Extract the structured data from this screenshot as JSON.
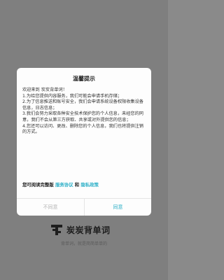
{
  "dialog": {
    "title": "温馨提示",
    "body_lines": [
      "欢迎来到 炭炭背单词！",
      "1.为给您提供内容服务，我们可能会申请手机存储；",
      "2.为了信息推送和账号安全，我们会申请系统设备权限收集设备信息，日志信息；",
      "3.我们会努力采取各种安全技术保护您的个人信息，未经您的同意，我们不会从第三方获取、共享或对外提供您的信息；",
      "4.您还可以访问、更改、删除您的个人信息，我们也将提供注销的方式。"
    ],
    "policy_prefix": "您可阅读完整版 ",
    "service_agreement": "服务协议",
    "and": " 和 ",
    "privacy_policy": "隐私政策",
    "disagree_label": "不同意",
    "agree_label": "同意"
  },
  "brand": {
    "app_name": "炭炭背单词",
    "tagline": "背单词，就是简简单单的"
  },
  "colors": {
    "overlay": "#7f7f7f",
    "accent": "#2eb0c8",
    "disabled_text": "#b5b5b5"
  }
}
